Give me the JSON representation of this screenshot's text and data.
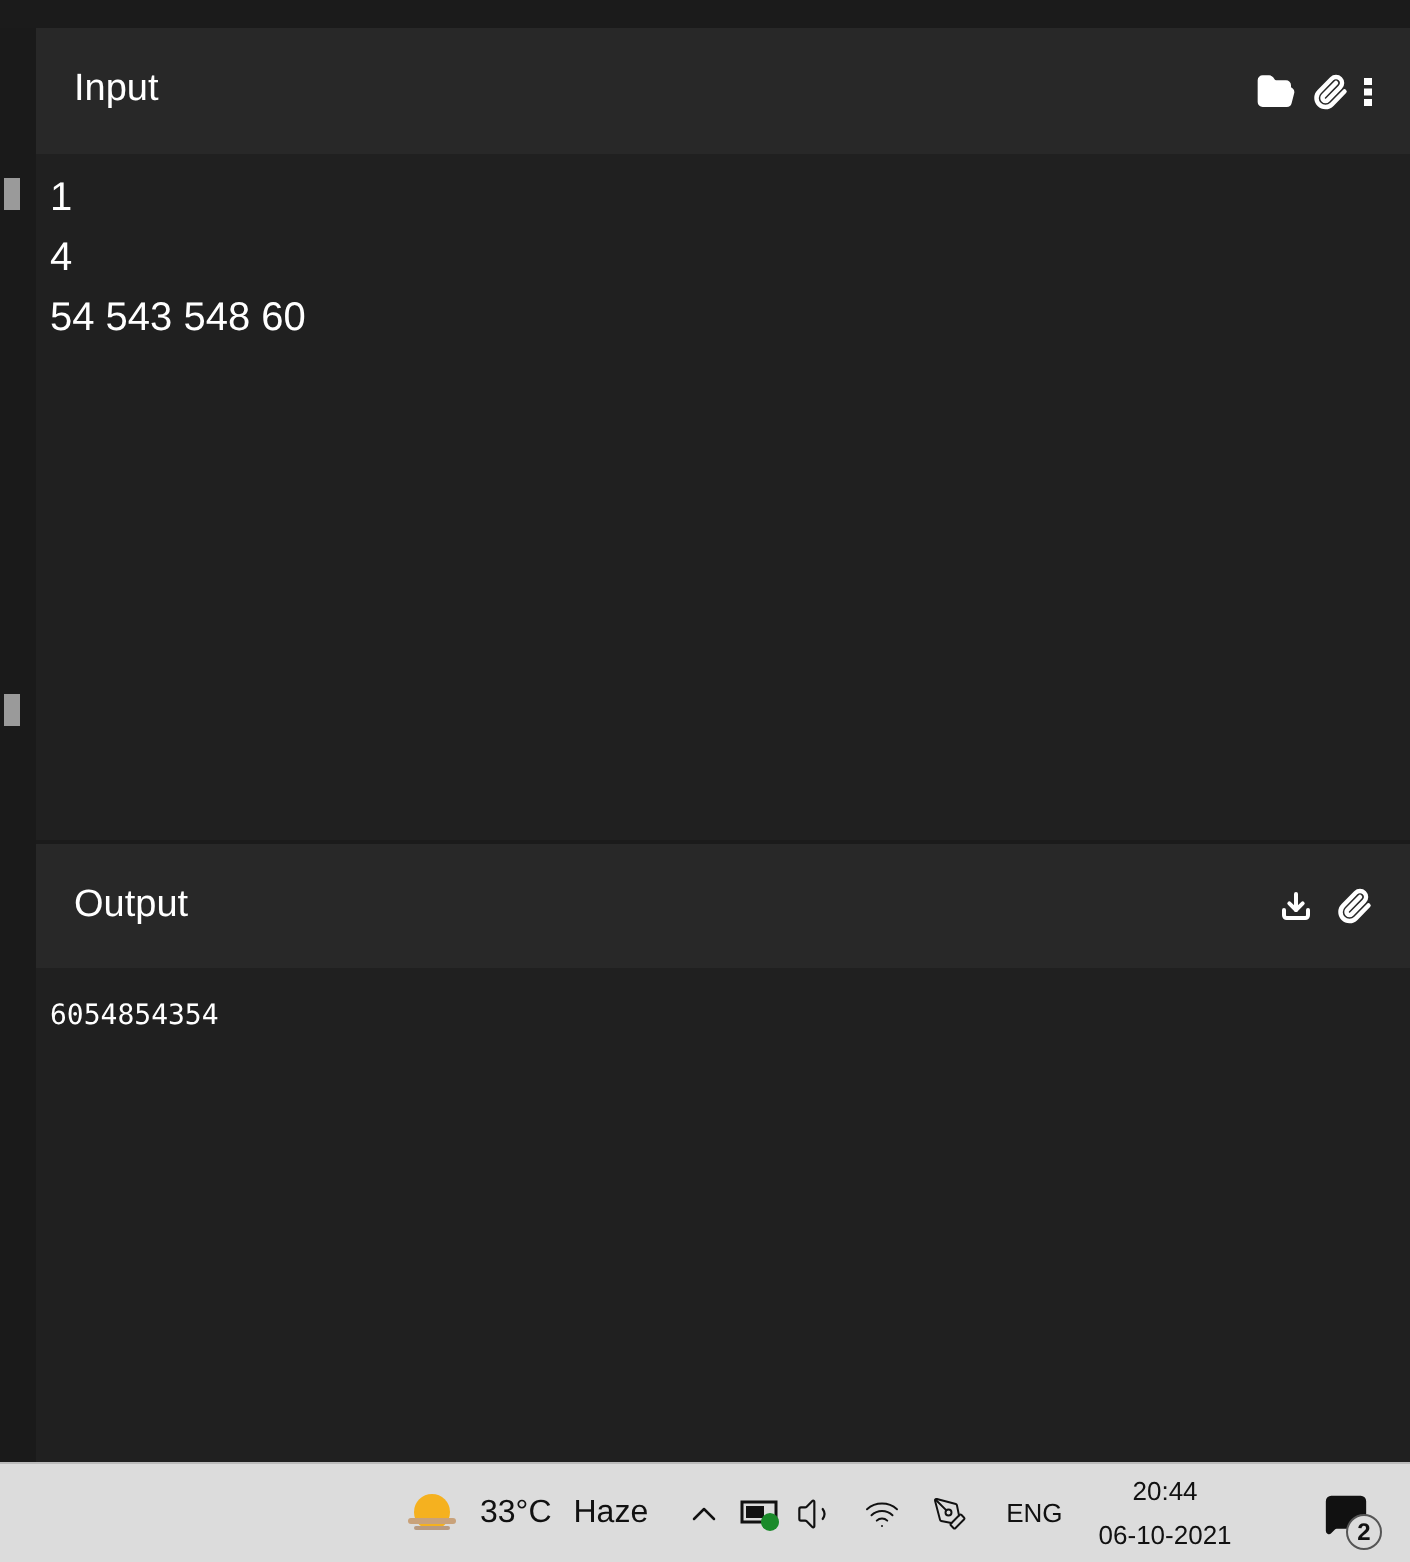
{
  "input": {
    "title": "Input",
    "lines": [
      "1",
      "4",
      "54 543 548 60"
    ]
  },
  "output": {
    "title": "Output",
    "text": "6054854354"
  },
  "taskbar": {
    "temperature": "33°C",
    "condition": "Haze",
    "language": "ENG",
    "time": "20:44",
    "date": "06-10-2021",
    "notifications": "2"
  }
}
